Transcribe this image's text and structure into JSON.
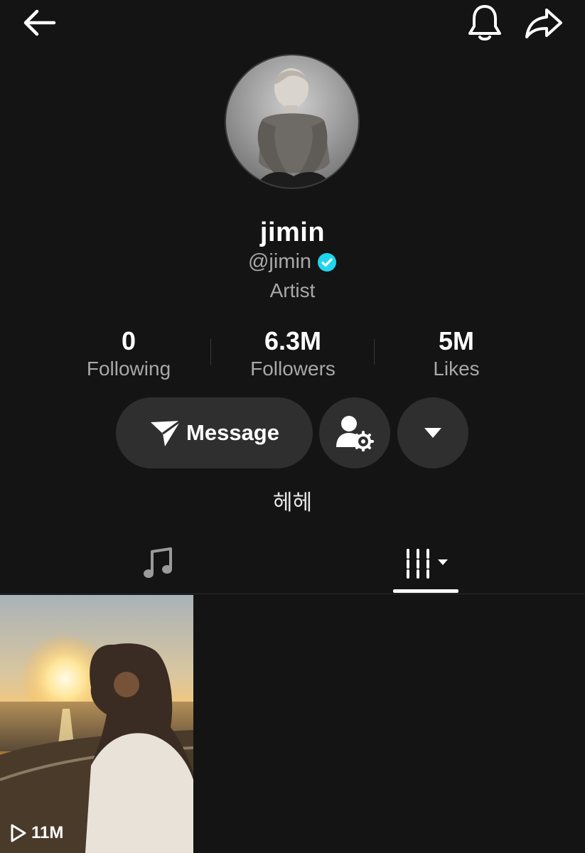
{
  "header": {
    "back_icon": "arrow-left-icon",
    "bell_icon": "bell-icon",
    "share_icon": "share-arrow-icon"
  },
  "profile": {
    "display_name": "jimin",
    "handle": "@jimin",
    "verified": true,
    "category": "Artist",
    "bio": "헤헤"
  },
  "stats": {
    "following": {
      "value": "0",
      "label": "Following"
    },
    "followers": {
      "value": "6.3M",
      "label": "Followers"
    },
    "likes": {
      "value": "5M",
      "label": "Likes"
    }
  },
  "actions": {
    "message_label": "Message",
    "message_icon": "send-icon",
    "friend_icon": "user-settings-icon",
    "more_icon": "caret-down-icon"
  },
  "tabs": [
    {
      "name": "music",
      "icon": "music-note-icon",
      "active": false
    },
    {
      "name": "videos",
      "icon": "grid-dropdown-icon",
      "active": true
    }
  ],
  "videos": [
    {
      "views": "11M",
      "icon": "play-outline-icon"
    }
  ],
  "colors": {
    "background": "#141414",
    "button_bg": "#2f2f2f",
    "verified_badge": "#20d5ec",
    "secondary_text": "#a8a8a8"
  }
}
